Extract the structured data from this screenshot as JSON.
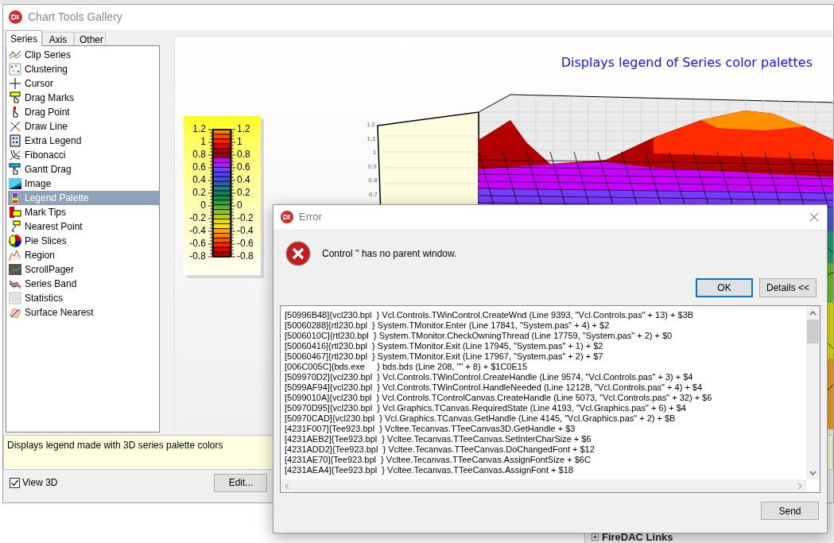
{
  "gallery_window": {
    "title": "Chart Tools Gallery"
  },
  "tabs": [
    {
      "label": "Series",
      "selected": true
    },
    {
      "label": "Axis",
      "selected": false
    },
    {
      "label": "Other",
      "selected": false
    }
  ],
  "tools": [
    {
      "label": "Clip Series",
      "selected": false
    },
    {
      "label": "Clustering",
      "selected": false
    },
    {
      "label": "Cursor",
      "selected": false
    },
    {
      "label": "Drag Marks",
      "selected": false
    },
    {
      "label": "Drag Point",
      "selected": false
    },
    {
      "label": "Draw Line",
      "selected": false
    },
    {
      "label": "Extra Legend",
      "selected": false
    },
    {
      "label": "Fibonacci",
      "selected": false
    },
    {
      "label": "Gantt Drag",
      "selected": false
    },
    {
      "label": "Image",
      "selected": false
    },
    {
      "label": "Legend Palette",
      "selected": true
    },
    {
      "label": "Mark Tips",
      "selected": false
    },
    {
      "label": "Nearest Point",
      "selected": false
    },
    {
      "label": "Pie Slices",
      "selected": false
    },
    {
      "label": "Region",
      "selected": false
    },
    {
      "label": "ScrollPager",
      "selected": false
    },
    {
      "label": "Series Band",
      "selected": false
    },
    {
      "label": "Statistics",
      "selected": false
    },
    {
      "label": "Surface Nearest",
      "selected": false
    }
  ],
  "chart": {
    "title": "Displays legend of Series color palettes",
    "legend_left_labels": [
      "1.2",
      "1",
      "0.8",
      "0.6",
      "0.4",
      "0.2",
      "0",
      "-0.2",
      "-0.4",
      "-0.6",
      "-0.8"
    ],
    "legend_right_labels": [
      "1.2",
      "1",
      "0.8",
      "0.6",
      "0.4",
      "0.2",
      "0",
      "-0.2",
      "-0.4",
      "-0.6",
      "-0.8"
    ],
    "axis_labels": [
      "1.2",
      "1.1",
      "1",
      "0.9",
      "0.8",
      "0.7"
    ]
  },
  "description": "Displays legend made with 3D series palette colors",
  "view_3d": {
    "label": "View 3D",
    "checked": true
  },
  "edit_button": "Edit...",
  "error_dialog": {
    "title": "Error",
    "message": "Control '' has no parent window.",
    "buttons": [
      {
        "label": "OK",
        "default": true
      },
      {
        "label": "Details <<",
        "default": false
      }
    ],
    "details": [
      "[50996B48]{vcl230.bpl  } Vcl.Controls.TWinControl.CreateWnd (Line 9393, \"Vcl.Controls.pas\" + 13) + $3B",
      "[50060288]{rtl230.bpl  } System.TMonitor.Enter (Line 17841, \"System.pas\" + 4) + $2",
      "[5006010C]{rtl230.bpl  } System.TMonitor.CheckOwningThread (Line 17759, \"System.pas\" + 2) + $0",
      "[50060416]{rtl230.bpl  } System.TMonitor.Exit (Line 17945, \"System.pas\" + 1) + $2",
      "[50060467]{rtl230.bpl  } System.TMonitor.Exit (Line 17967, \"System.pas\" + 2) + $7",
      "[006C005C]{bds.exe     } bds.bds (Line 208, \"\" + 8) + $1C0E15",
      "[509970D2]{vcl230.bpl  } Vcl.Controls.TWinControl.CreateHandle (Line 9574, \"Vcl.Controls.pas\" + 3) + $4",
      "[5099AF94]{vcl230.bpl  } Vcl.Controls.TWinControl.HandleNeeded (Line 12128, \"Vcl.Controls.pas\" + 4) + $4",
      "[5099010A]{vcl230.bpl  } Vcl.Controls.TControlCanvas.CreateHandle (Line 5073, \"Vcl.Controls.pas\" + 32) + $6",
      "[50970D95]{vcl230.bpl  } Vcl.Graphics.TCanvas.RequiredState (Line 4193, \"Vcl.Graphics.pas\" + 6) + $4",
      "[50970CAD]{vcl230.bpl  } Vcl.Graphics.TCanvas.GetHandle (Line 4145, \"Vcl.Graphics.pas\" + 2) + $B",
      "[4231F007]{Tee923.bpl  } Vcltee.Tecanvas.TTeeCanvas3D.GetHandle + $3",
      "[4231AEB2]{Tee923.bpl  } Vcltee.Tecanvas.TTeeCanvas.SetInterCharSize + $6",
      "[4231ADD2]{Tee923.bpl  } Vcltee.Tecanvas.TTeeCanvas.DoChangedFont + $12",
      "[4231AE70]{Tee923.bpl  } Vcltee.Tecanvas.TTeeCanvas.AssignFontSize + $6C",
      "[4231AEA4]{Tee923.bpl  } Vcltee.Tecanvas.TTeeCanvas.AssignFont + $18"
    ],
    "send_button": "Send"
  },
  "background_panel": {
    "item": "FireDAC Links"
  }
}
